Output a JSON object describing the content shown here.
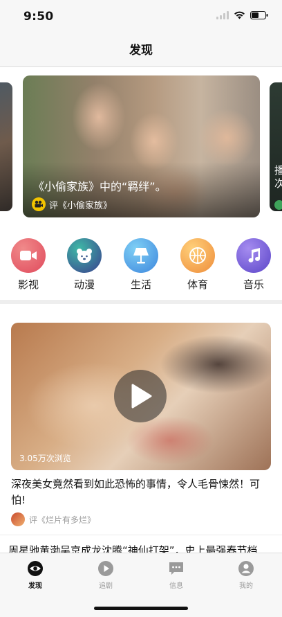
{
  "status_bar": {
    "time": "9:50"
  },
  "header": {
    "title": "发现"
  },
  "carousel": {
    "main": {
      "title": "《小偷家族》中的“羁绊”。",
      "source": "评《小偷家族》"
    },
    "right_peek": "播\n次"
  },
  "categories": [
    {
      "label": "影视",
      "icon": "video-camera-icon",
      "color": "#e85a66"
    },
    {
      "label": "动漫",
      "icon": "bear-icon",
      "color": "#2b8f9c"
    },
    {
      "label": "生活",
      "icon": "lamp-icon",
      "color": "#4ea6e6"
    },
    {
      "label": "体育",
      "icon": "basketball-icon",
      "color": "#f2a745"
    },
    {
      "label": "音乐",
      "icon": "music-note-icon",
      "color": "#6d57d6"
    }
  ],
  "feed": {
    "video": {
      "views": "3.05万次浏览",
      "title": "深夜美女竟然看到如此恐怖的事情，令人毛骨悚然！可怕!",
      "source": "评《烂片有多烂》"
    },
    "next_title": "周星驰黄渤吴京成龙沈腾“神仙打架”，史上最强春节档"
  },
  "tab_bar": {
    "tabs": [
      {
        "label": "发现",
        "icon": "eye-icon",
        "active": true
      },
      {
        "label": "追剧",
        "icon": "play-circle-icon",
        "active": false
      },
      {
        "label": "信息",
        "icon": "message-icon",
        "active": false
      },
      {
        "label": "我的",
        "icon": "profile-icon",
        "active": false
      }
    ]
  }
}
